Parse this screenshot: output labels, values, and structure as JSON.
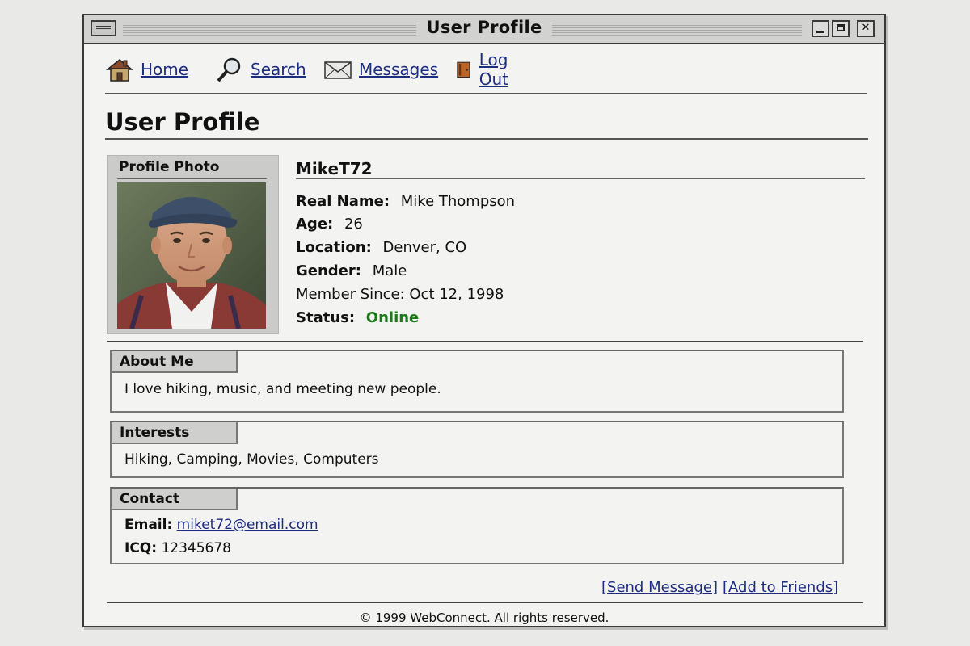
{
  "window": {
    "title": "User Profile"
  },
  "nav": [
    {
      "label": "Home",
      "icon": "house-icon"
    },
    {
      "label": "Search",
      "icon": "magnifier-icon"
    },
    {
      "label": "Messages",
      "icon": "envelope-icon"
    },
    {
      "label": "Log Out",
      "icon": "door-icon"
    }
  ],
  "page": {
    "title": "User Profile"
  },
  "profile": {
    "photo_label": "Profile Photo",
    "username": "MikeT72",
    "fields": {
      "real_name": {
        "label": "Real Name:",
        "value": "Mike Thompson"
      },
      "age": {
        "label": "Age:",
        "value": "26"
      },
      "location": {
        "label": "Location:",
        "value": "Denver, CO"
      },
      "gender": {
        "label": "Gender:",
        "value": "Male"
      },
      "member_since": {
        "label": "Member Since:",
        "value": "Oct 12, 1998"
      },
      "status": {
        "label": "Status:",
        "value": "Online"
      }
    }
  },
  "sections": {
    "about": {
      "title": "About Me",
      "text": "I love hiking, music, and meeting new people."
    },
    "interests": {
      "title": "Interests",
      "text": "Hiking, Camping, Movies, Computers"
    },
    "contact": {
      "title": "Contact",
      "email_label": "Email:",
      "email": "miket72@email.com",
      "icq_label": "ICQ:",
      "icq": "12345678"
    }
  },
  "actions": {
    "send_message": "[Send Message]",
    "add_friends": "[Add to Friends]"
  },
  "footer": {
    "text": "© 1999 WebConnect. All rights reserved."
  },
  "colors": {
    "link": "#1d2d80",
    "online": "#1a7a1a",
    "titlebar": "#d2d2d0"
  }
}
